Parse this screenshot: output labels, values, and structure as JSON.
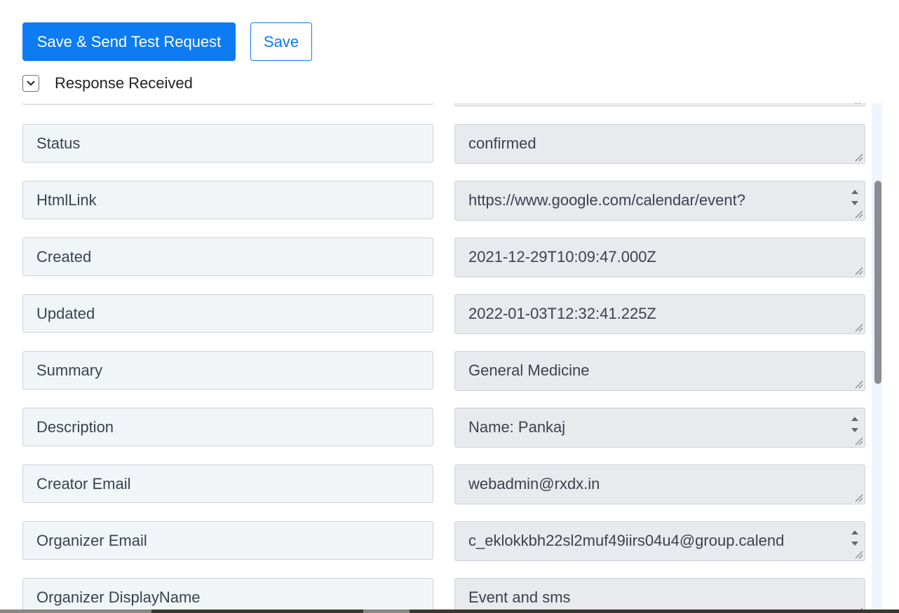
{
  "actions": {
    "primary_label": "Save & Send Test Request",
    "secondary_label": "Save"
  },
  "response": {
    "toggle_label": "Response Received"
  },
  "fields": [
    {
      "key": "Status",
      "value": "confirmed",
      "value_second_line": "",
      "scrollable": false
    },
    {
      "key": "HtmlLink",
      "value": "https://www.google.com/calendar/event?",
      "value_second_line": "",
      "scrollable": true
    },
    {
      "key": "Created",
      "value": "2021-12-29T10:09:47.000Z",
      "value_second_line": "",
      "scrollable": false
    },
    {
      "key": "Updated",
      "value": "2022-01-03T12:32:41.225Z",
      "value_second_line": "",
      "scrollable": false
    },
    {
      "key": "Summary",
      "value": "General Medicine",
      "value_second_line": "",
      "scrollable": false
    },
    {
      "key": "Description",
      "value": "Name: Pankaj",
      "value_second_line": "",
      "scrollable": true
    },
    {
      "key": "Creator Email",
      "value": "webadmin@rxdx.in",
      "value_second_line": "",
      "scrollable": false
    },
    {
      "key": "Organizer Email",
      "value": "c_eklokkbh22sl2muf49iirs04u4@group.calend",
      "value_second_line": "",
      "scrollable": true
    },
    {
      "key": "Organizer DisplayName",
      "value": "Event and sms",
      "value_second_line": "",
      "scrollable": false
    }
  ],
  "colors": {
    "accent": "#0d7bf2",
    "key_bg": "#f2f5f8",
    "value_bg": "#e8eaed",
    "text": "#3b4250"
  },
  "icons": {
    "toggle": "chevron-down-icon",
    "textarea_resize": "resize-grip-icon",
    "spinner": "spinner-arrows-icon"
  }
}
